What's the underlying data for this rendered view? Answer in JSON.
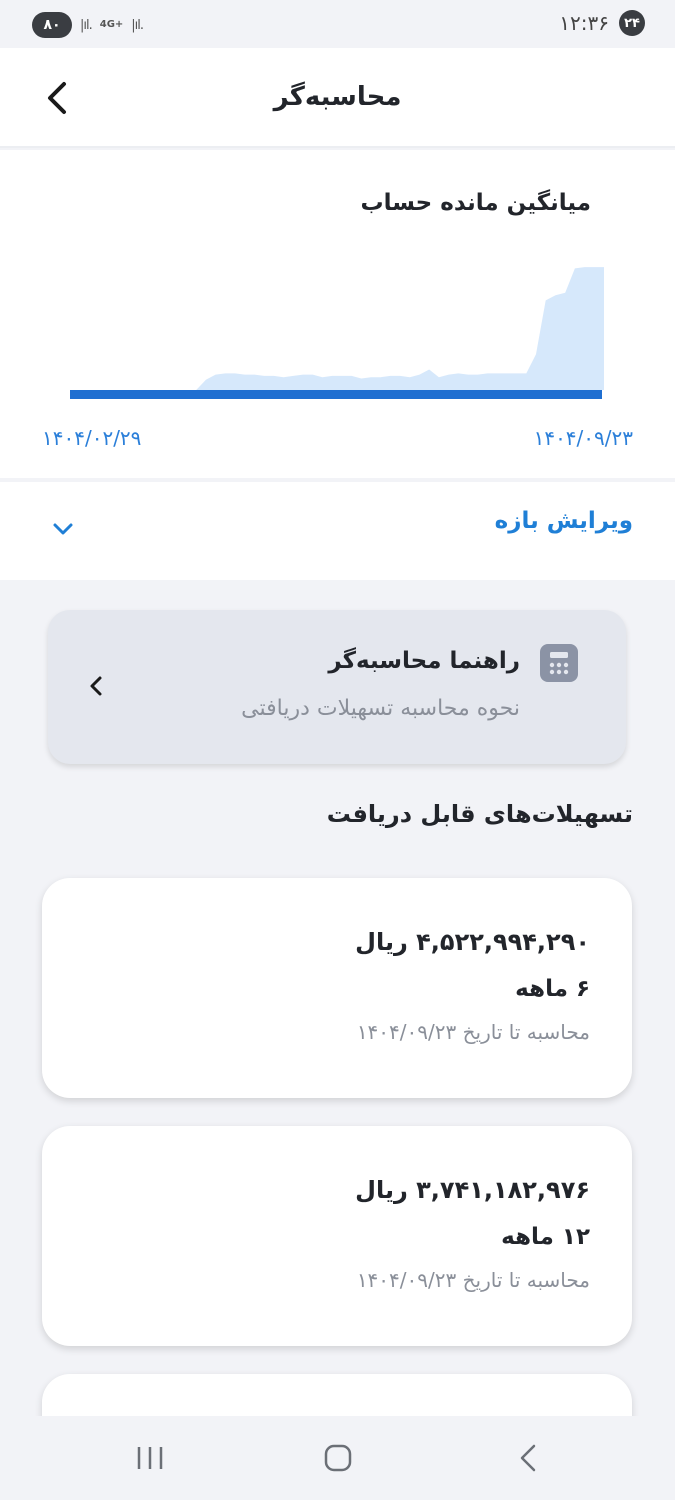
{
  "status_bar": {
    "battery": "۸۰",
    "network": "4G+",
    "time": "۱۲:۳۶",
    "notification_badge": "۲۴"
  },
  "header": {
    "title": "محاسبه‌گر",
    "back_icon": "chevron-left-icon"
  },
  "chart_card": {
    "title": "میانگین مانده حساب",
    "chart_data": {
      "type": "area",
      "x_start": "۱۴۰۴/۰۲/۲۹",
      "x_end": "۱۴۰۴/۰۹/۲۳",
      "values": [
        0,
        0,
        0,
        0,
        0,
        0,
        0,
        0,
        0,
        0,
        0,
        0,
        0,
        0,
        0.08,
        0.12,
        0.13,
        0.13,
        0.12,
        0.12,
        0.11,
        0.11,
        0.1,
        0.11,
        0.12,
        0.12,
        0.1,
        0.11,
        0.11,
        0.11,
        0.09,
        0.1,
        0.1,
        0.11,
        0.11,
        0.1,
        0.12,
        0.16,
        0.1,
        0.12,
        0.13,
        0.12,
        0.12,
        0.13,
        0.13,
        0.13,
        0.13,
        0.13,
        0.28,
        0.7,
        0.74,
        0.76,
        0.95,
        0.96,
        0.96,
        0.96
      ],
      "colors": {
        "area": "#d6e8fb",
        "baseline": "#1f6fd1"
      },
      "grid": false
    }
  },
  "edit_range": {
    "label": "ویرایش بازه",
    "icon": "chevron-down-icon"
  },
  "guide": {
    "title": "راهنما محاسبه‌گر",
    "subtitle": "نحوه محاسبه تسهیلات دریافتی",
    "icon": "calculator-icon"
  },
  "section_title": "تسهیلات‌های قابل دریافت",
  "loans": [
    {
      "amount": "۴,۵۲۲,۹۹۴,۲۹۰ ریال",
      "term": "۶ ماهه",
      "calc_date": "محاسبه تا تاریخ ۱۴۰۴/۰۹/۲۳"
    },
    {
      "amount": "۳,۷۴۱,۱۸۲,۹۷۶ ریال",
      "term": "۱۲ ماهه",
      "calc_date": "محاسبه تا تاریخ ۱۴۰۴/۰۹/۲۳"
    }
  ],
  "colors": {
    "accent": "#1f7fd6",
    "muted": "#8a8f99"
  }
}
